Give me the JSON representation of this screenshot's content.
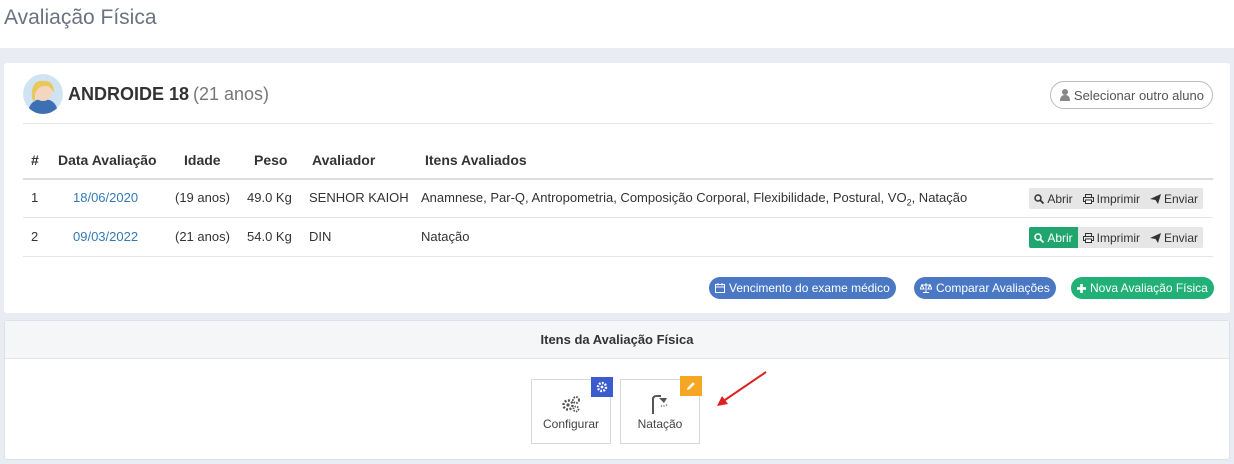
{
  "page": {
    "title": "Avaliação Física"
  },
  "student": {
    "name": "ANDROIDE 18",
    "age": "(21 anos)",
    "select_button": "Selecionar outro aluno"
  },
  "table": {
    "headers": [
      "#",
      "Data Avaliação",
      "Idade",
      "Peso",
      "Avaliador",
      "Itens Avaliados"
    ],
    "rows": [
      {
        "num": "1",
        "date": "18/06/2020",
        "age": "(19 anos)",
        "weight": "49.0 Kg",
        "evaluator": "SENHOR KAIOH",
        "items_before": "Anamnese, Par-Q, Antropometria, Composição Corporal, Flexibilidade, Postural, VO",
        "items_sub": "2",
        "items_after": ", Natação",
        "actions": [
          "Abrir",
          "Imprimir",
          "Enviar"
        ]
      },
      {
        "num": "2",
        "date": "09/03/2022",
        "age": "(21 anos)",
        "weight": "54.0 Kg",
        "evaluator": "DIN",
        "items_before": "Natação",
        "items_sub": "",
        "items_after": "",
        "actions": [
          "Abrir",
          "Imprimir",
          "Enviar"
        ]
      }
    ]
  },
  "buttons": {
    "exam_due": "Vencimento do exame médico",
    "compare": "Comparar Avaliações",
    "new_eval": "Nova Avaliação Física"
  },
  "items_panel": {
    "title": "Itens da Avaliação Física",
    "tiles": [
      {
        "label": "Configurar",
        "icon": "gears-icon",
        "badge_icon": "gear-icon",
        "badge_color": "#3a5ccc"
      },
      {
        "label": "Natação",
        "icon": "shower-icon",
        "badge_icon": "pencil-icon",
        "badge_color": "#f5a623"
      }
    ]
  },
  "colors": {
    "link": "#337ab7",
    "green": "#1fa56d",
    "blue_pill": "#4a78c4",
    "annotation_arrow": "#e02020"
  }
}
